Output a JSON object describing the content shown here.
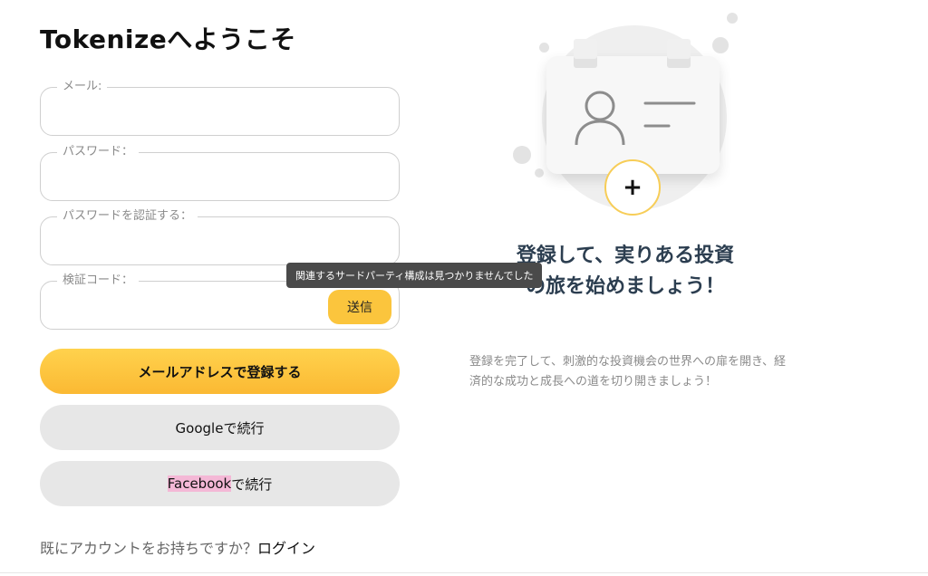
{
  "form": {
    "title": "Tokenizeへようこそ",
    "email_label": "メール:",
    "password_label": "パスワード：",
    "confirm_label": "パスワードを認証する：",
    "code_label": "検証コード：",
    "send_button": "送信",
    "tooltip": "関連するサードパーティ構成は見つかりませんでした",
    "register_button": "メールアドレスで登録する",
    "google_button": "Googleで続行",
    "facebook_prefix": "Facebook",
    "facebook_suffix": "で続行",
    "login_prompt": "既にアカウントをお持ちですか？",
    "login_link": "ログイン"
  },
  "promo": {
    "headline": "登録して、実りある投資の旅を始めましょう！",
    "subtext": "登録を完了して、刺激的な投資機会の世界への扉を開き、経済的な成功と成長への道を切り開きましょう！",
    "plus_icon": "+"
  },
  "colors": {
    "accent": "#fbc53d",
    "grey_button": "#e7e7e7",
    "headline": "#2c3e50"
  },
  "icons": {
    "user": "user-icon",
    "plus": "plus-icon"
  }
}
